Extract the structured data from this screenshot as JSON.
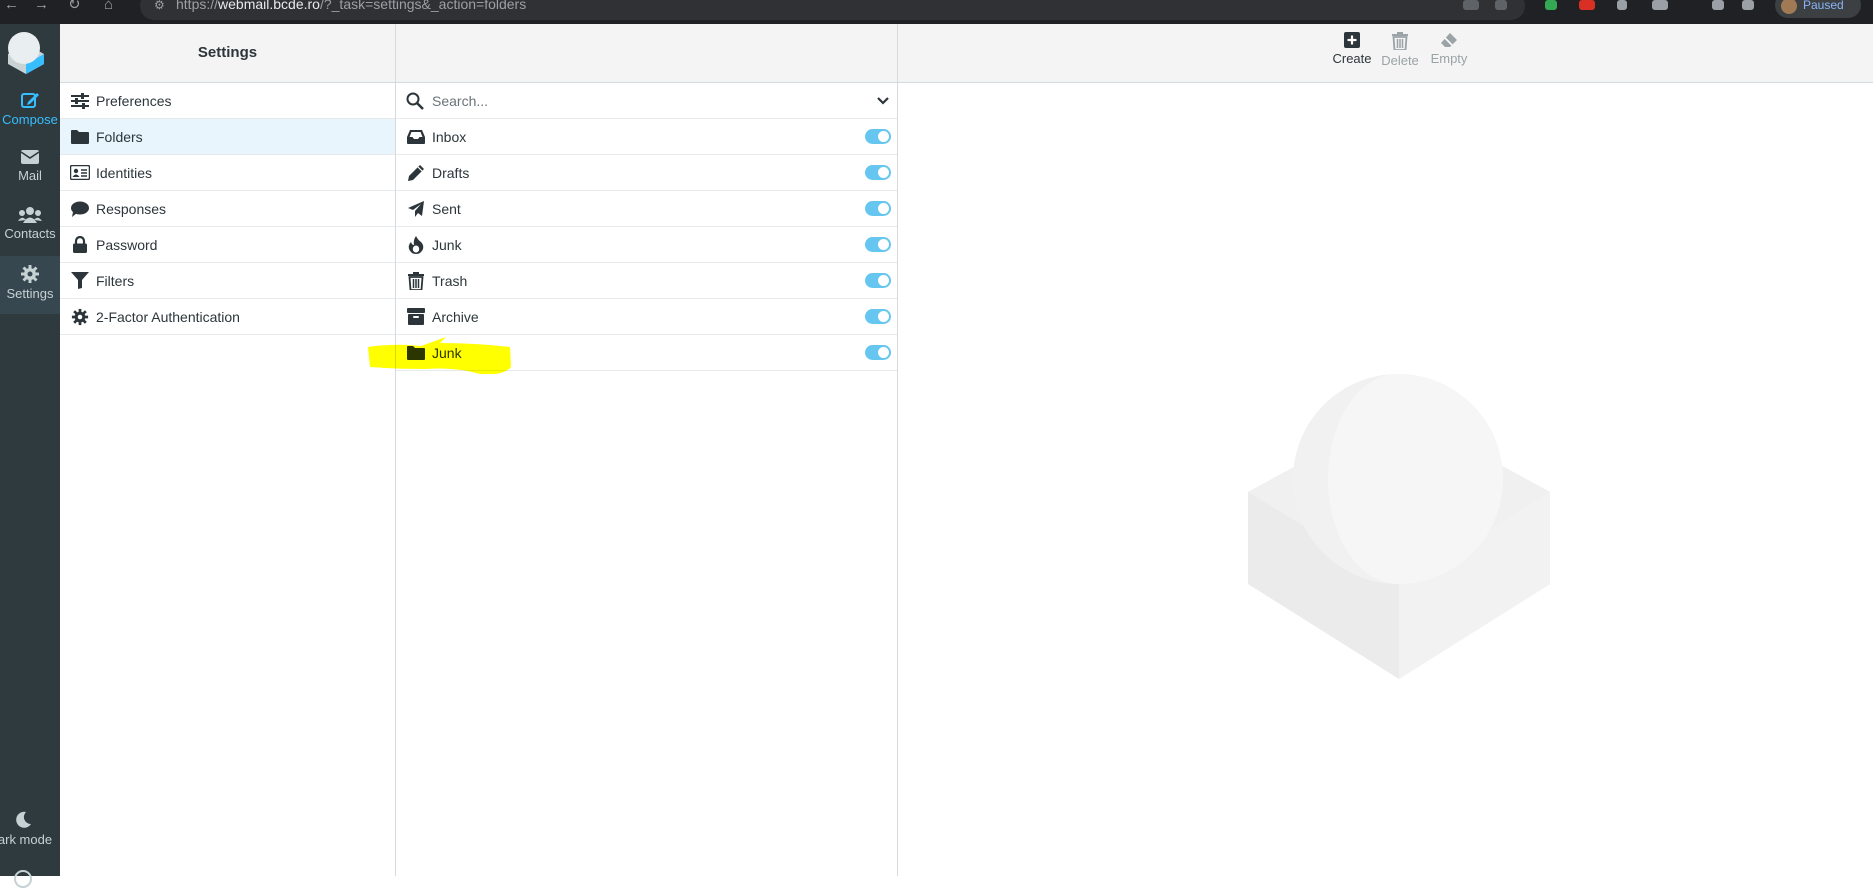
{
  "browser": {
    "url_prefix": "https://",
    "url_domain": "webmail.bcde.ro",
    "url_path": "/?_task=settings&_action=folders",
    "profile_status": "Paused"
  },
  "nav": {
    "compose": "Compose",
    "mail": "Mail",
    "contacts": "Contacts",
    "settings": "Settings",
    "dark_mode": "ark mode"
  },
  "settings_panel": {
    "title": "Settings",
    "items": [
      {
        "label": "Preferences",
        "icon": "sliders-icon"
      },
      {
        "label": "Folders",
        "icon": "folder-icon"
      },
      {
        "label": "Identities",
        "icon": "id-card-icon"
      },
      {
        "label": "Responses",
        "icon": "comment-icon"
      },
      {
        "label": "Password",
        "icon": "lock-icon"
      },
      {
        "label": "Filters",
        "icon": "filter-icon"
      },
      {
        "label": "2-Factor Authentication",
        "icon": "gear-icon"
      }
    ]
  },
  "folders_panel": {
    "search_placeholder": "Search...",
    "folders": [
      {
        "label": "Inbox",
        "icon": "inbox-icon",
        "subscribed": true
      },
      {
        "label": "Drafts",
        "icon": "pencil-icon",
        "subscribed": true
      },
      {
        "label": "Sent",
        "icon": "paper-plane-icon",
        "subscribed": true
      },
      {
        "label": "Junk",
        "icon": "fire-icon",
        "subscribed": true
      },
      {
        "label": "Trash",
        "icon": "trash-icon",
        "subscribed": true
      },
      {
        "label": "Archive",
        "icon": "archive-icon",
        "subscribed": true
      },
      {
        "label": "Junk",
        "icon": "folder-icon",
        "subscribed": true
      }
    ]
  },
  "toolbar": {
    "create": "Create",
    "delete": "Delete",
    "empty": "Empty"
  },
  "colors": {
    "nav_bg": "#2f3a3f",
    "accent": "#37beff",
    "toggle_on": "#67c6ef",
    "highlight": "#ffff00",
    "selected_row": "#e8f5fc"
  }
}
